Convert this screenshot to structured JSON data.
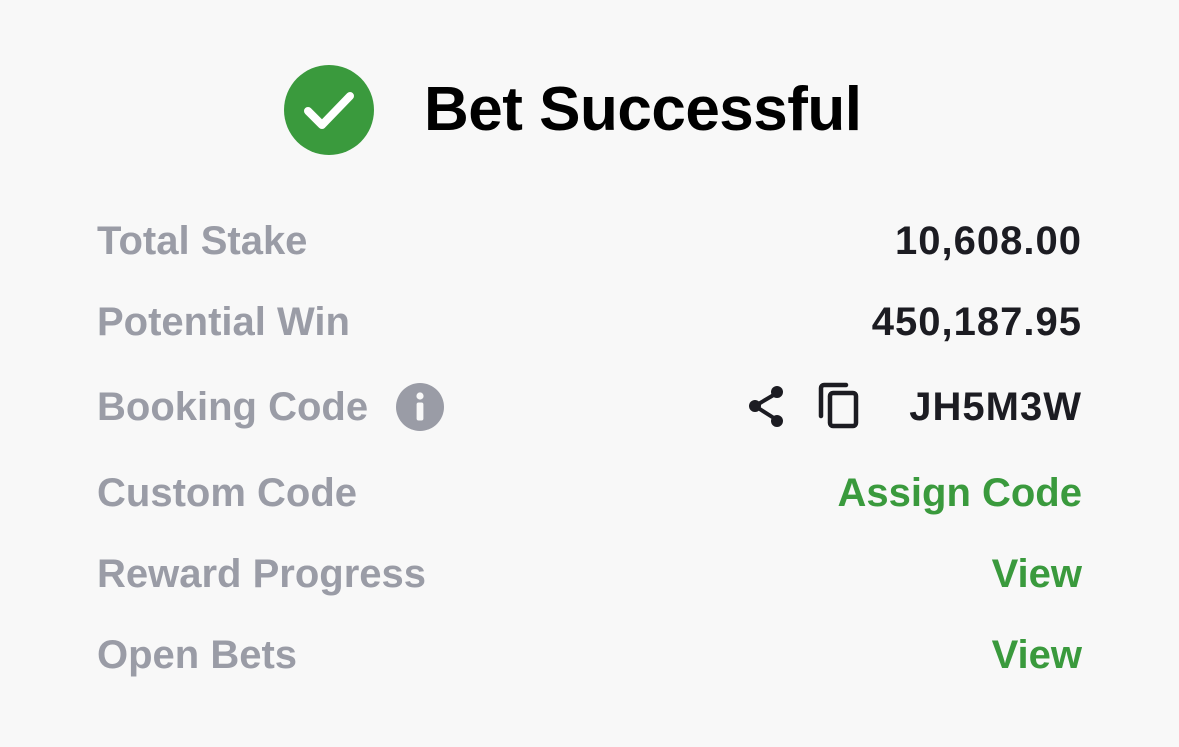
{
  "header": {
    "title": "Bet Successful",
    "icon": "check-circle-icon",
    "accent_color": "#3a9a3d"
  },
  "details": {
    "total_stake": {
      "label": "Total Stake",
      "value": "10,608.00"
    },
    "potential_win": {
      "label": "Potential Win",
      "value": "450,187.95"
    },
    "booking_code": {
      "label": "Booking Code",
      "info_icon": "info-icon",
      "share_icon": "share-icon",
      "copy_icon": "copy-icon",
      "value": "JH5M3W"
    },
    "custom_code": {
      "label": "Custom Code",
      "action": "Assign Code"
    },
    "reward_progress": {
      "label": "Reward Progress",
      "action": "View"
    },
    "open_bets": {
      "label": "Open Bets",
      "action": "View"
    }
  },
  "colors": {
    "background": "#f8f8f8",
    "label": "#9a9ca6",
    "value": "#1c1c22",
    "link": "#3a9a3d"
  }
}
